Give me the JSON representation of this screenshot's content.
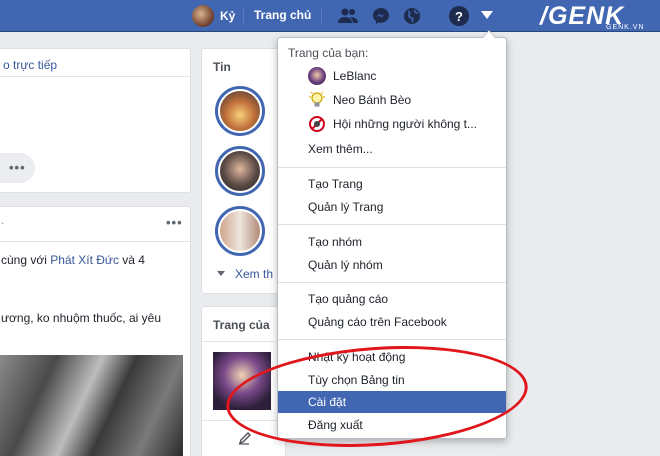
{
  "topbar": {
    "profile_name": "Kỷ",
    "home_label": "Trang chủ",
    "icons": [
      "friends-icon",
      "messenger-icon",
      "globe-icon",
      "help-icon",
      "caret-down-icon"
    ],
    "help_glyph": "?"
  },
  "watermark": {
    "logo": "/GENK",
    "domain": "GENK.VN"
  },
  "left": {
    "live_link": "o trực tiếp",
    "more_dots": "•••",
    "post_dots": "•••",
    "post_line1_prefix": "cùng với ",
    "post_line1_link": "Phát Xít Đức",
    "post_line1_suffix": " và 4",
    "post_line2": "ương, ko nhuộm thuốc, ai yêu"
  },
  "middle": {
    "stories_title": "Tin",
    "see_more": "Xem th",
    "pages_title": "Trang của"
  },
  "dropdown": {
    "header": "Trang của bạn:",
    "pages": [
      {
        "name": "LeBlanc",
        "icon": "leblanc-avatar-icon"
      },
      {
        "name": "Neo Bánh Bèo",
        "icon": "lightbulb-icon"
      },
      {
        "name": "Hội những người không t...",
        "icon": "no-symbol-icon"
      }
    ],
    "see_more": "Xem thêm...",
    "group1": [
      "Tạo Trang",
      "Quản lý Trang"
    ],
    "group2": [
      "Tạo nhóm",
      "Quản lý nhóm"
    ],
    "group3": [
      "Tạo quảng cáo",
      "Quảng cáo trên Facebook"
    ],
    "group4": [
      "Nhật ký hoạt động",
      "Tùy chọn Bảng tin",
      "Cài đặt",
      "Đăng xuất"
    ],
    "active_item": "Cài đặt"
  },
  "colors": {
    "topbar": "#4267b2",
    "highlight": "#4267b2",
    "annotation": "#e0161b"
  }
}
